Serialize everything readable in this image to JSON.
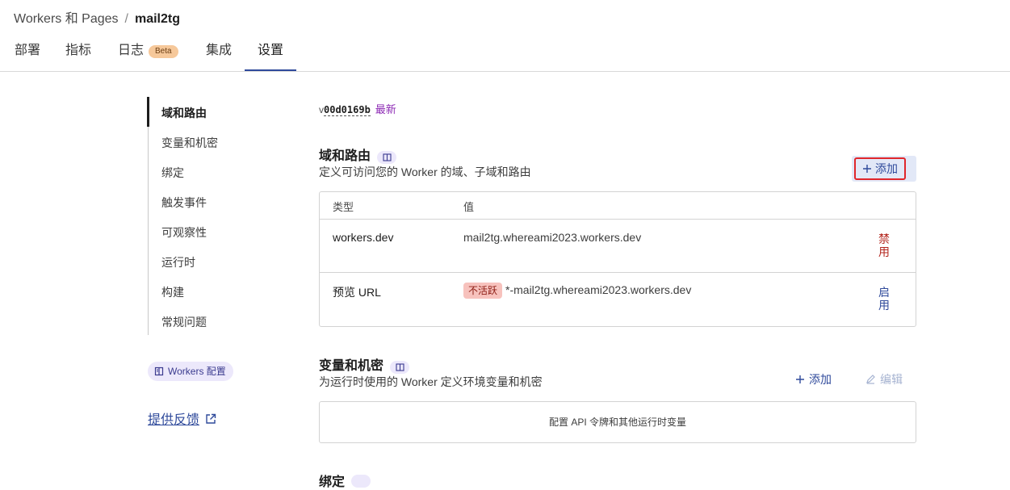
{
  "breadcrumb": {
    "parent": "Workers 和 Pages",
    "separator": "/",
    "current": "mail2tg"
  },
  "tabs": [
    {
      "label": "部署"
    },
    {
      "label": "指标"
    },
    {
      "label": "日志",
      "badge": "Beta"
    },
    {
      "label": "集成"
    },
    {
      "label": "设置",
      "active": true
    }
  ],
  "sidenav": {
    "items": [
      "域和路由",
      "变量和机密",
      "绑定",
      "触发事件",
      "可观察性",
      "运行时",
      "构建",
      "常规问题"
    ],
    "active_index": 0,
    "workers_config_label": "Workers 配置",
    "feedback_label": "提供反馈"
  },
  "version": {
    "prefix": "v",
    "hash": "00d0169b",
    "status": "最新"
  },
  "domains": {
    "title": "域和路由",
    "description": "定义可访问您的 Worker 的域、子域和路由",
    "add_label": "添加",
    "columns": {
      "type": "类型",
      "value": "值"
    },
    "rows": [
      {
        "type": "workers.dev",
        "badge": "",
        "value": "mail2tg.whereami2023.workers.dev",
        "action": "禁用"
      },
      {
        "type": "预览 URL",
        "badge": "不活跃",
        "value": "*-mail2tg.whereami2023.workers.dev",
        "action": "启用"
      }
    ]
  },
  "variables": {
    "title": "变量和机密",
    "description": "为运行时使用的 Worker 定义环境变量和机密",
    "add_label": "添加",
    "edit_label": "编辑",
    "empty_text": "配置 API 令牌和其他运行时变量"
  },
  "bindings": {
    "title": "绑定"
  },
  "colors": {
    "accent": "#2f4a9b",
    "danger": "#b3261e",
    "latest": "#8e2bb5",
    "highlight": "#e0262b"
  }
}
